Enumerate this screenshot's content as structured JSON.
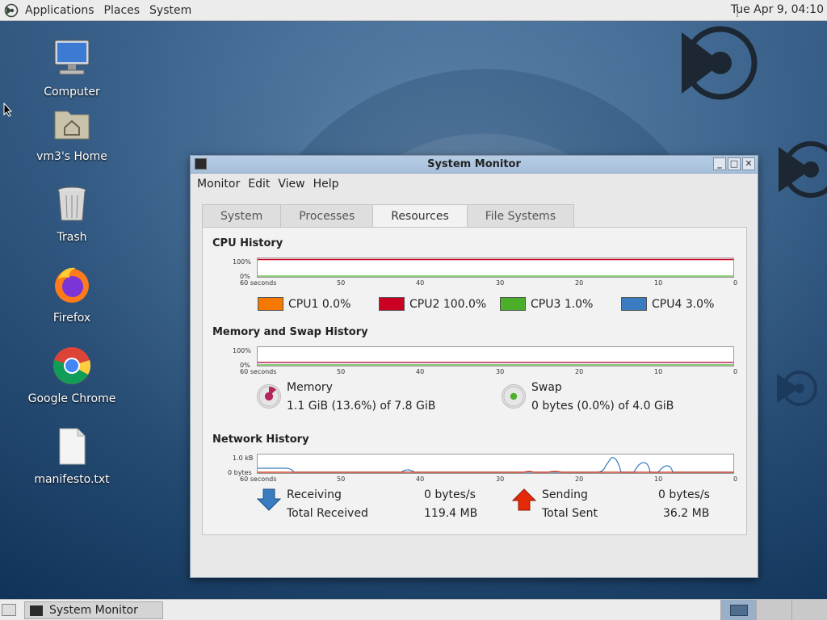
{
  "top_panel": {
    "menus": [
      "Applications",
      "Places",
      "System"
    ],
    "clock": "Tue Apr 9, 04:10"
  },
  "desktop_icons": [
    {
      "label": "Computer"
    },
    {
      "label": "vm3's Home"
    },
    {
      "label": "Trash"
    },
    {
      "label": "Firefox"
    },
    {
      "label": "Google Chrome"
    },
    {
      "label": "manifesto.txt"
    }
  ],
  "window": {
    "title": "System Monitor",
    "menubar": [
      "Monitor",
      "Edit",
      "View",
      "Help"
    ],
    "tabs": [
      "System",
      "Processes",
      "Resources",
      "File Systems"
    ],
    "active_tab": "Resources",
    "cpu": {
      "title": "CPU History",
      "y_top": "100%",
      "y_bottom": "0%",
      "x_labels": [
        "60 seconds",
        "50",
        "40",
        "30",
        "20",
        "10",
        "0"
      ],
      "series": [
        {
          "name": "CPU1",
          "value": "0.0%",
          "color": "#f57900"
        },
        {
          "name": "CPU2",
          "value": "100.0%",
          "color": "#cc0022"
        },
        {
          "name": "CPU3",
          "value": "1.0%",
          "color": "#4caf2a"
        },
        {
          "name": "CPU4",
          "value": "3.0%",
          "color": "#3a7cc0"
        }
      ]
    },
    "memory": {
      "title": "Memory and Swap History",
      "y_top": "100%",
      "y_bottom": "0%",
      "x_labels": [
        "60 seconds",
        "50",
        "40",
        "30",
        "20",
        "10",
        "0"
      ],
      "memory_label": "Memory",
      "memory_value": "1.1 GiB (13.6%) of 7.8 GiB",
      "memory_fraction": 0.136,
      "swap_label": "Swap",
      "swap_value": "0 bytes (0.0%) of 4.0 GiB",
      "memory_color": "#b3275a",
      "swap_color": "#4caf2a"
    },
    "network": {
      "title": "Network History",
      "y_top": "1.0 kB",
      "y_bottom": "0 bytes",
      "x_labels": [
        "60 seconds",
        "50",
        "40",
        "30",
        "20",
        "10",
        "0"
      ],
      "receiving_label": "Receiving",
      "receiving_value": "0 bytes/s",
      "total_received_label": "Total Received",
      "total_received_value": "119.4 MB",
      "sending_label": "Sending",
      "sending_value": "0 bytes/s",
      "total_sent_label": "Total Sent",
      "total_sent_value": "36.2 MB",
      "receive_color": "#3a7cc0",
      "send_color": "#cc2200"
    }
  },
  "taskbar": {
    "task_label": "System Monitor"
  }
}
